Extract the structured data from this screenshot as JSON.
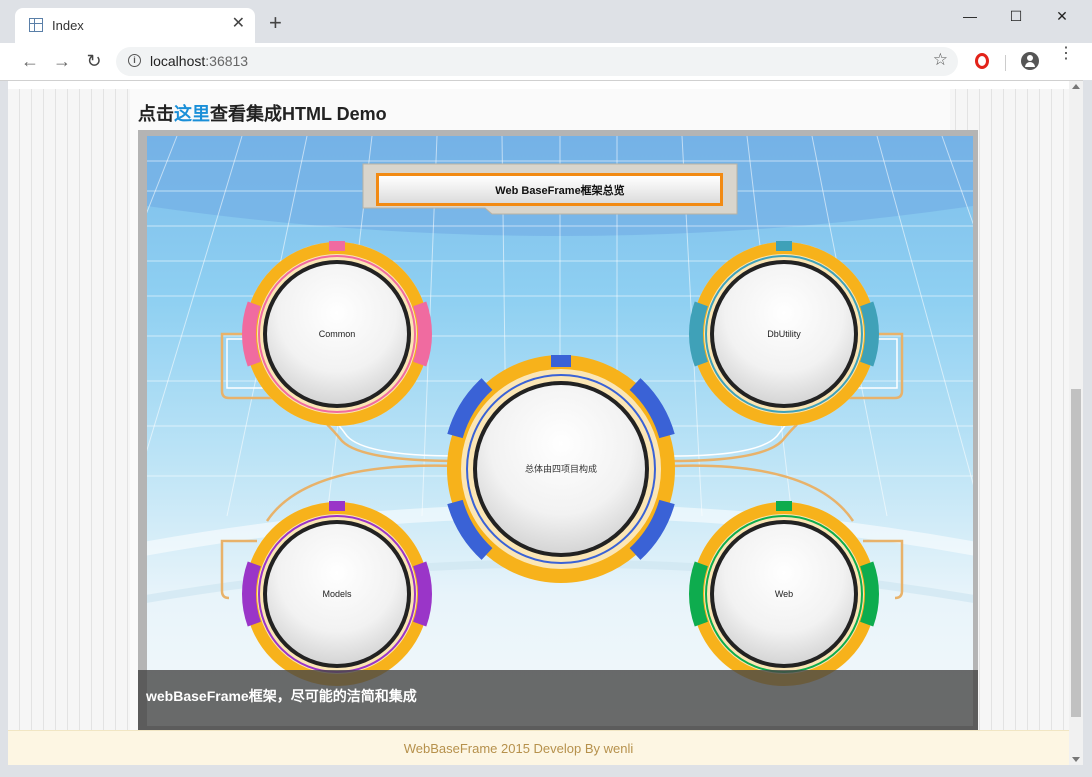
{
  "browser": {
    "tab_title": "Index",
    "tab_close": "✕",
    "new_tab": "+",
    "window_controls": {
      "minimize": "—",
      "maximize": "☐",
      "close": "✕"
    },
    "nav": {
      "back": "←",
      "forward": "→",
      "reload": "↻"
    },
    "url_host": "localhost",
    "url_port": ":36813",
    "info_icon": "i",
    "star_icon": "☆",
    "menu_icon": "⋮"
  },
  "page": {
    "heading_prefix": "点击",
    "heading_link": "这里",
    "heading_suffix": "查看集成HTML Demo",
    "diagram": {
      "title": "Web BaseFrame框架总览",
      "center_label": "总体由四项目构成",
      "modules": [
        {
          "label": "Common",
          "accent": "#f06ba0"
        },
        {
          "label": "DbUtility",
          "accent": "#3fa1b8"
        },
        {
          "label": "Models",
          "accent": "#9a35c8"
        },
        {
          "label": "Web",
          "accent": "#0eac4e"
        }
      ],
      "center_accent": "#3a62d6"
    },
    "caption": "webBaseFrame框架，尽可能的洁简和集成",
    "footer": "WebBaseFrame 2015 Develop By wenli"
  },
  "colors": {
    "link": "#1a8fd8",
    "footer_text": "#b6914c",
    "ring_gold": "#f7b21b"
  }
}
